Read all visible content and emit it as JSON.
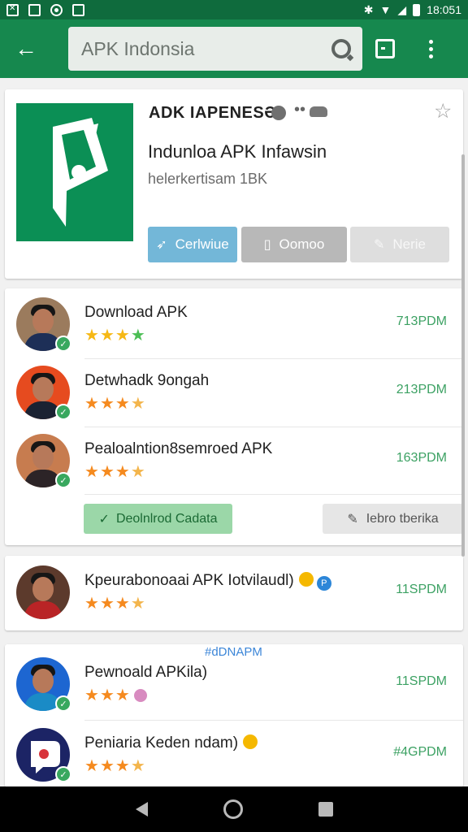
{
  "status_bar": {
    "time": "18:051",
    "icons": [
      "photo-icon",
      "image-icon",
      "record-icon",
      "gallery-icon",
      "bluetooth-icon",
      "wifi-icon",
      "signal-icon",
      "battery-icon"
    ]
  },
  "app_bar": {
    "search_text": "APK Indonsia",
    "accent": "#16884e",
    "status_color": "#0f6b3d"
  },
  "app_header": {
    "name": "ADK IAPENESƏ",
    "subtitle": "Indunloa APK Infawsin",
    "meta": "helerkertisam 1BK",
    "buttons": {
      "primary": "Cerlwiue",
      "secondary": "Oomoo",
      "tertiary": "Nerie"
    }
  },
  "list": {
    "download_button": "Deolnlrod Cadata",
    "edit_button": "Iebro tberika",
    "hashtag": "#dDNAPM",
    "items": [
      {
        "title": "Download APK",
        "rating": 4,
        "time": "713PDM"
      },
      {
        "title": "Detwhadk 9ongah",
        "rating": 3.5,
        "time": "213PDM"
      },
      {
        "title": "Pealoalntion8semroed APK",
        "rating": 3.5,
        "time": "163PDM"
      },
      {
        "title": "Kpeurabonoaai APK Iotvilaudl)",
        "rating": 3.5,
        "time": "11SPDM"
      },
      {
        "title": "Pewnoald APKila)",
        "rating": 3,
        "time": "11SPDM"
      },
      {
        "title": "Peniaria Keden ndam)",
        "rating": 3.5,
        "time": "#4GPDM"
      }
    ]
  }
}
